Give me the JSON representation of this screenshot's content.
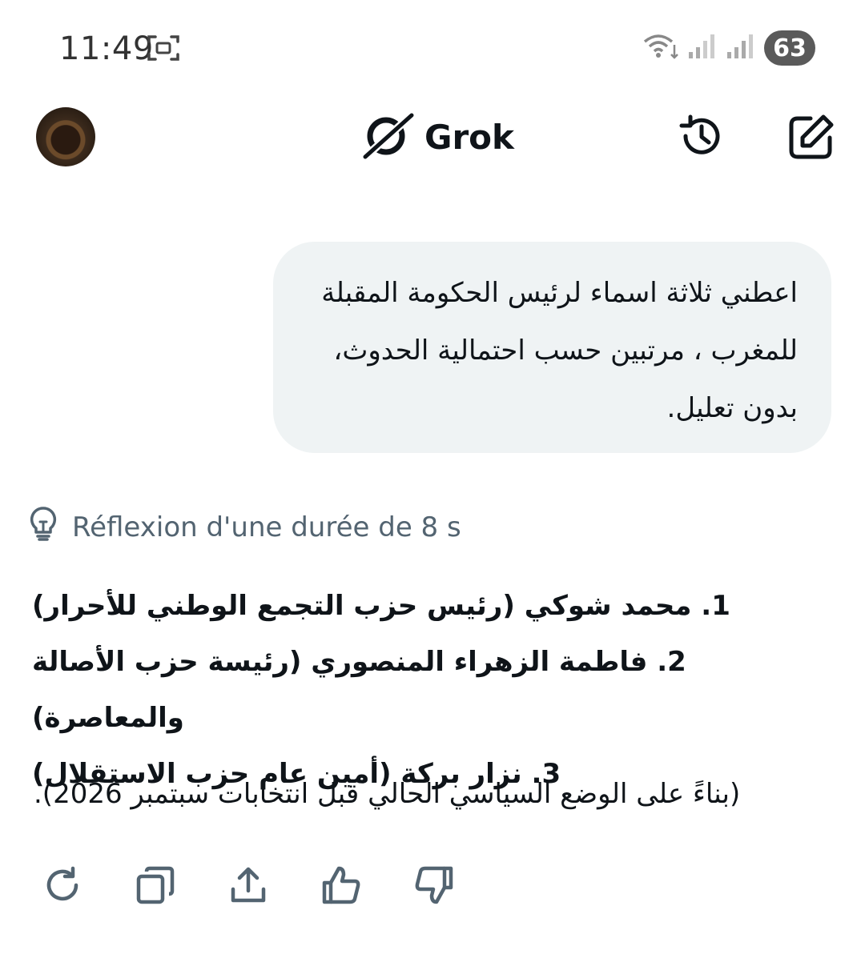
{
  "status_bar": {
    "time": "11:49",
    "battery": "63",
    "icons": [
      "screenshot-icon",
      "wifi-icon",
      "signal-icon",
      "signal-icon"
    ]
  },
  "header": {
    "title": "Grok",
    "logo_icon": "grok-logo-icon",
    "history_icon": "history-icon",
    "new_chat_icon": "edit-icon"
  },
  "user_message": {
    "lines": [
      "اعطني ثلاثة اسماء لرئيس الحكومة المقبلة",
      "للمغرب ، مرتبين حسب احتمالية الحدوث،",
      "بدون تعليل."
    ]
  },
  "thinking": {
    "icon": "lightbulb-icon",
    "label": "Réflexion d'une durée de 8 s"
  },
  "answer": {
    "items": [
      "1. محمد شوكي (رئيس حزب التجمع الوطني للأحرار)",
      "2. فاطمة الزهراء المنصوري (رئيسة حزب الأصالة والمعاصرة)",
      "3. نزار بركة (أمين عام حزب الاستقلال)"
    ],
    "note": "(بناءً على الوضع السياسي الحالي قبل انتخابات سبتمبر 2026)."
  },
  "actions": [
    "regenerate-icon",
    "copy-icon",
    "share-icon",
    "thumbs-up-icon",
    "thumbs-down-icon"
  ],
  "colors": {
    "bubble_bg": "#eff3f4",
    "secondary_text": "#536471",
    "primary_text": "#0f1419"
  }
}
